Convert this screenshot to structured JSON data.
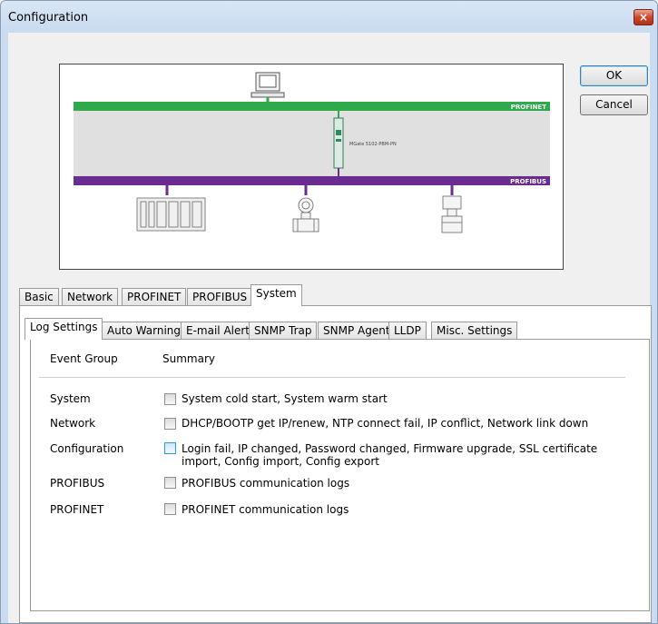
{
  "window": {
    "title": "Configuration",
    "close_glyph": "×"
  },
  "buttons": {
    "ok": "OK",
    "cancel": "Cancel"
  },
  "diagram": {
    "profinet_label": "PROFINET",
    "profibus_label": "PROFIBUS",
    "device_label": "MGate 5102-PBM-PN",
    "colors": {
      "profinet": "#2eaa4a",
      "profibus": "#6b2c91"
    }
  },
  "main_tabs": [
    "Basic",
    "Network",
    "PROFINET",
    "PROFIBUS",
    "System"
  ],
  "sub_tabs": [
    "Log Settings",
    "Auto Warning",
    "E-mail Alert",
    "SNMP Trap",
    "SNMP Agent",
    "LLDP",
    "Misc. Settings"
  ],
  "log_settings": {
    "header_group": "Event Group",
    "header_summary": "Summary",
    "rows": [
      {
        "group": "System",
        "summary": "System cold start, System warm start",
        "checked": false
      },
      {
        "group": "Network",
        "summary": "DHCP/BOOTP get IP/renew, NTP connect fail, IP conflict, Network link down",
        "checked": false
      },
      {
        "group": "Configuration",
        "summary": "Login fail, IP changed, Password changed, Firmware upgrade, SSL certificate import, Config import, Config export",
        "checked": false
      },
      {
        "group": "PROFIBUS",
        "summary": "PROFIBUS communication logs",
        "checked": false
      },
      {
        "group": "PROFINET",
        "summary": "PROFINET communication logs",
        "checked": false
      }
    ]
  }
}
